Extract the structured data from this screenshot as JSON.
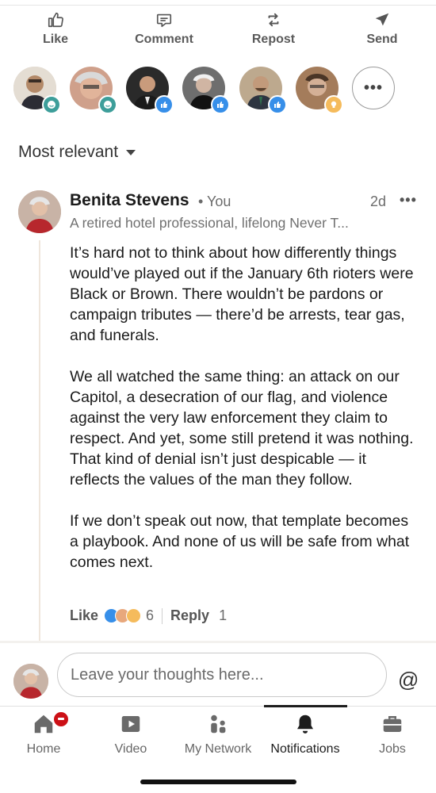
{
  "post_actions": [
    {
      "label": "Like",
      "icon": "thumbs-up-icon"
    },
    {
      "label": "Comment",
      "icon": "comment-icon"
    },
    {
      "label": "Repost",
      "icon": "repost-icon"
    },
    {
      "label": "Send",
      "icon": "send-icon"
    }
  ],
  "reactors": [
    {
      "reaction": "smile-reaction-icon",
      "reaction_color": "#3d9e9a"
    },
    {
      "reaction": "smile-reaction-icon",
      "reaction_color": "#3d9e9a"
    },
    {
      "reaction": "thumbs-up-reaction-icon",
      "reaction_color": "#378fe9"
    },
    {
      "reaction": "thumbs-up-reaction-icon",
      "reaction_color": "#378fe9"
    },
    {
      "reaction": "thumbs-up-reaction-icon",
      "reaction_color": "#378fe9"
    },
    {
      "reaction": "insightful-reaction-icon",
      "reaction_color": "#f5bb5c"
    }
  ],
  "sort": {
    "label": "Most relevant"
  },
  "comment": {
    "author": "Benita Stevens",
    "relation": "• You",
    "headline": "A retired hotel professional, lifelong Never T...",
    "time": "2d",
    "paragraphs": [
      "It’s hard not to think about how differently things would’ve played out if the January 6th rioters were Black or Brown. There wouldn’t be pardons or campaign tributes — there’d be arrests, tear gas, and funerals.",
      "We all watched the same thing: an attack on our Capitol, a desecration of our flag, and violence against the very law enforcement they claim to respect. And yet, some still pretend it was nothing. That kind of denial isn’t just despicable — it reflects the values of the man they follow.",
      "If we don’t speak out now, that template becomes a playbook. And none of us will be safe from what comes next."
    ],
    "like_label": "Like",
    "reaction_count": "6",
    "reply_label": "Reply",
    "reply_count": "1"
  },
  "composer": {
    "placeholder": "Leave your thoughts here...",
    "mention_symbol": "@"
  },
  "bottom_nav": [
    {
      "label": "Home",
      "icon": "home-icon"
    },
    {
      "label": "Video",
      "icon": "video-icon"
    },
    {
      "label": "My Network",
      "icon": "my-network-icon"
    },
    {
      "label": "Notifications",
      "icon": "bell-icon",
      "active": true
    },
    {
      "label": "Jobs",
      "icon": "briefcase-icon"
    }
  ],
  "colors": {
    "accent_blue": "#378fe9",
    "badge_red": "#cc1016",
    "text_dark": "#1a1a1a",
    "text_muted": "#6b6b6b"
  }
}
